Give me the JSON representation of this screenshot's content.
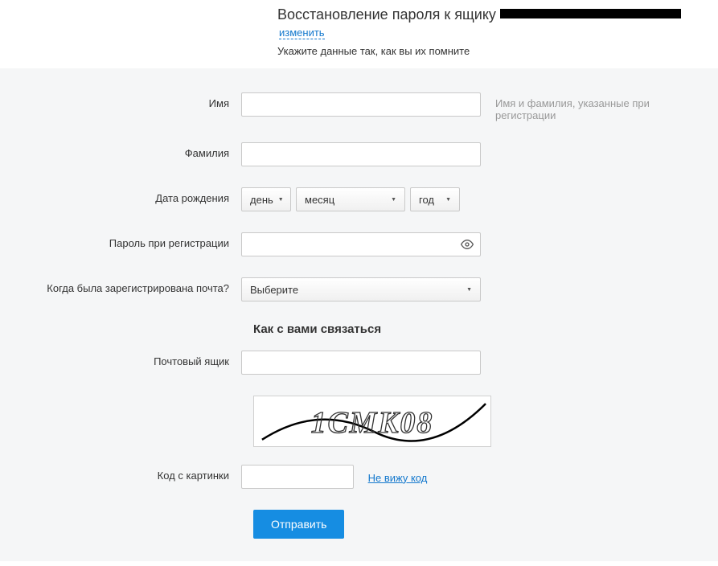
{
  "header": {
    "title_prefix": "Восстановление пароля к ящику ",
    "change_link": "изменить",
    "subtitle": "Укажите данные так, как вы их помните"
  },
  "labels": {
    "first_name": "Имя",
    "last_name": "Фамилия",
    "birth_date": "Дата рождения",
    "reg_password": "Пароль при регистрации",
    "when_registered": "Когда была зарегистрирована почта?",
    "contact_heading": "Как с вами связаться",
    "mailbox": "Почтовый ящик",
    "captcha_code": "Код с картинки"
  },
  "hints": {
    "name_hint": "Имя и фамилия, указанные при регистрации"
  },
  "selects": {
    "day": "день",
    "month": "месяц",
    "year": "год",
    "when": "Выберите"
  },
  "captcha": {
    "text": "1CMK08",
    "cannot_see": "Не вижу код"
  },
  "buttons": {
    "submit": "Отправить"
  }
}
